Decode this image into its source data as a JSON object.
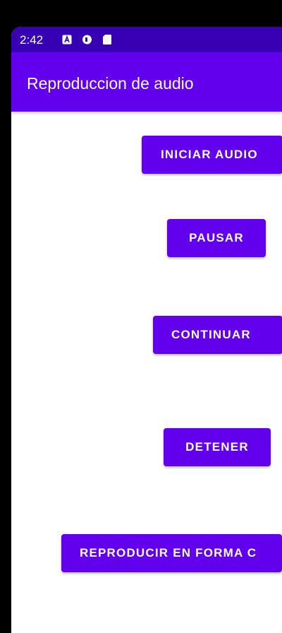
{
  "status_bar": {
    "time": "2:42",
    "icons": [
      "accessibility-a-icon",
      "sync-circle-icon",
      "sd-card-icon"
    ],
    "background": "#3700B3"
  },
  "app_bar": {
    "title": "Reproduccion de audio",
    "background": "#6200EE"
  },
  "buttons": {
    "start": "INICIAR AUDIO",
    "pause": "PAUSAR",
    "continue": "CONTINUAR",
    "stop": "DETENER",
    "loop": "REPRODUCIR EN FORMA C"
  },
  "colors": {
    "primary": "#6200EE",
    "primary_dark": "#3700B3",
    "on_primary": "#FFFFFF",
    "background": "#FFFFFF"
  }
}
